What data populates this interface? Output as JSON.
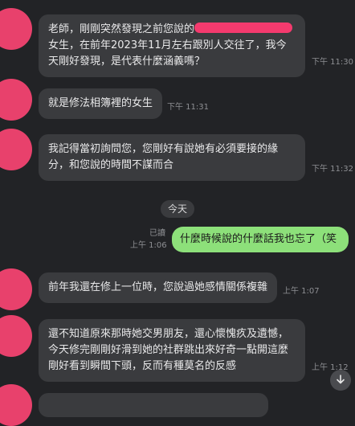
{
  "chat": {
    "messages": [
      {
        "text_before": "老師，剛剛突然發現之前您說的",
        "text_after": "女生，在前年2023年11月左右跟別人交往了，我今天剛好發現，是代表什麼涵義嗎？",
        "time": "下午 11:30"
      },
      {
        "text": "就是修法相簿裡的女生",
        "time": "下午 11:31"
      },
      {
        "text": "我記得當初詢問您，您剛好有說她有必須要接的緣分，和您說的時間不謀而合",
        "time": "下午 11:32"
      }
    ],
    "date_divider": "今天",
    "outgoing": {
      "text": "什麼時候說的什麼話我也忘了（笑",
      "read_label": "已讀",
      "time": "上午 1:06"
    },
    "replies": [
      {
        "text": "前年我還在修上一位時，您說過她感情關係複雜",
        "time": "上午 1:07"
      },
      {
        "text": "還不知道原來那時她交男朋友，還心懷愧疚及遺憾，今天修完剛剛好滑到她的社群跳出來好奇一點開這麼剛好看到瞬間下頭，反而有種莫名的反感",
        "time": "上午 1:12"
      }
    ],
    "scroll_button_icon": "arrow-down-icon",
    "colors": {
      "background": "#222326",
      "incoming_bubble": "#3a3b3e",
      "outgoing_bubble": "#8de07a",
      "avatar": "#e8416c",
      "redaction": "#f43a6e"
    }
  }
}
